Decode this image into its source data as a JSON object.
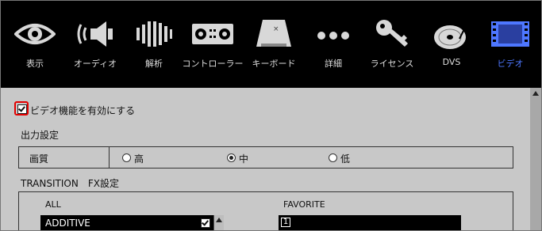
{
  "toolbar": {
    "items": [
      {
        "label": "表示",
        "icon": "eye-icon"
      },
      {
        "label": "オーディオ",
        "icon": "speaker-icon"
      },
      {
        "label": "解析",
        "icon": "waveform-icon"
      },
      {
        "label": "コントローラー",
        "icon": "controller-icon"
      },
      {
        "label": "キーボード",
        "icon": "keyboard-key-icon"
      },
      {
        "label": "詳細",
        "icon": "more-dots-icon"
      },
      {
        "label": "ライセンス",
        "icon": "key-icon"
      },
      {
        "label": "DVS",
        "icon": "turntable-icon"
      },
      {
        "label": "ビデオ",
        "icon": "film-icon"
      }
    ],
    "active_index": 8,
    "active_color": "#4e77ff"
  },
  "main": {
    "enable_video_label": "ビデオ機能を有効にする",
    "enable_video_checked": true,
    "output_section_label": "出力設定",
    "quality": {
      "label": "画質",
      "options": [
        "高",
        "中",
        "低"
      ],
      "selected": "中"
    },
    "fx_section_label": "TRANSITION　FX設定",
    "all_header": "ALL",
    "all_items": [
      {
        "label": "ADDITIVE",
        "checked": true
      }
    ],
    "favorite_header": "FAVORITE",
    "favorite_items": [
      {
        "number": "1"
      }
    ]
  },
  "colors": {
    "highlight": "#e30000",
    "panel_bg": "#c8c8c8",
    "toolbar_bg": "#000000"
  }
}
